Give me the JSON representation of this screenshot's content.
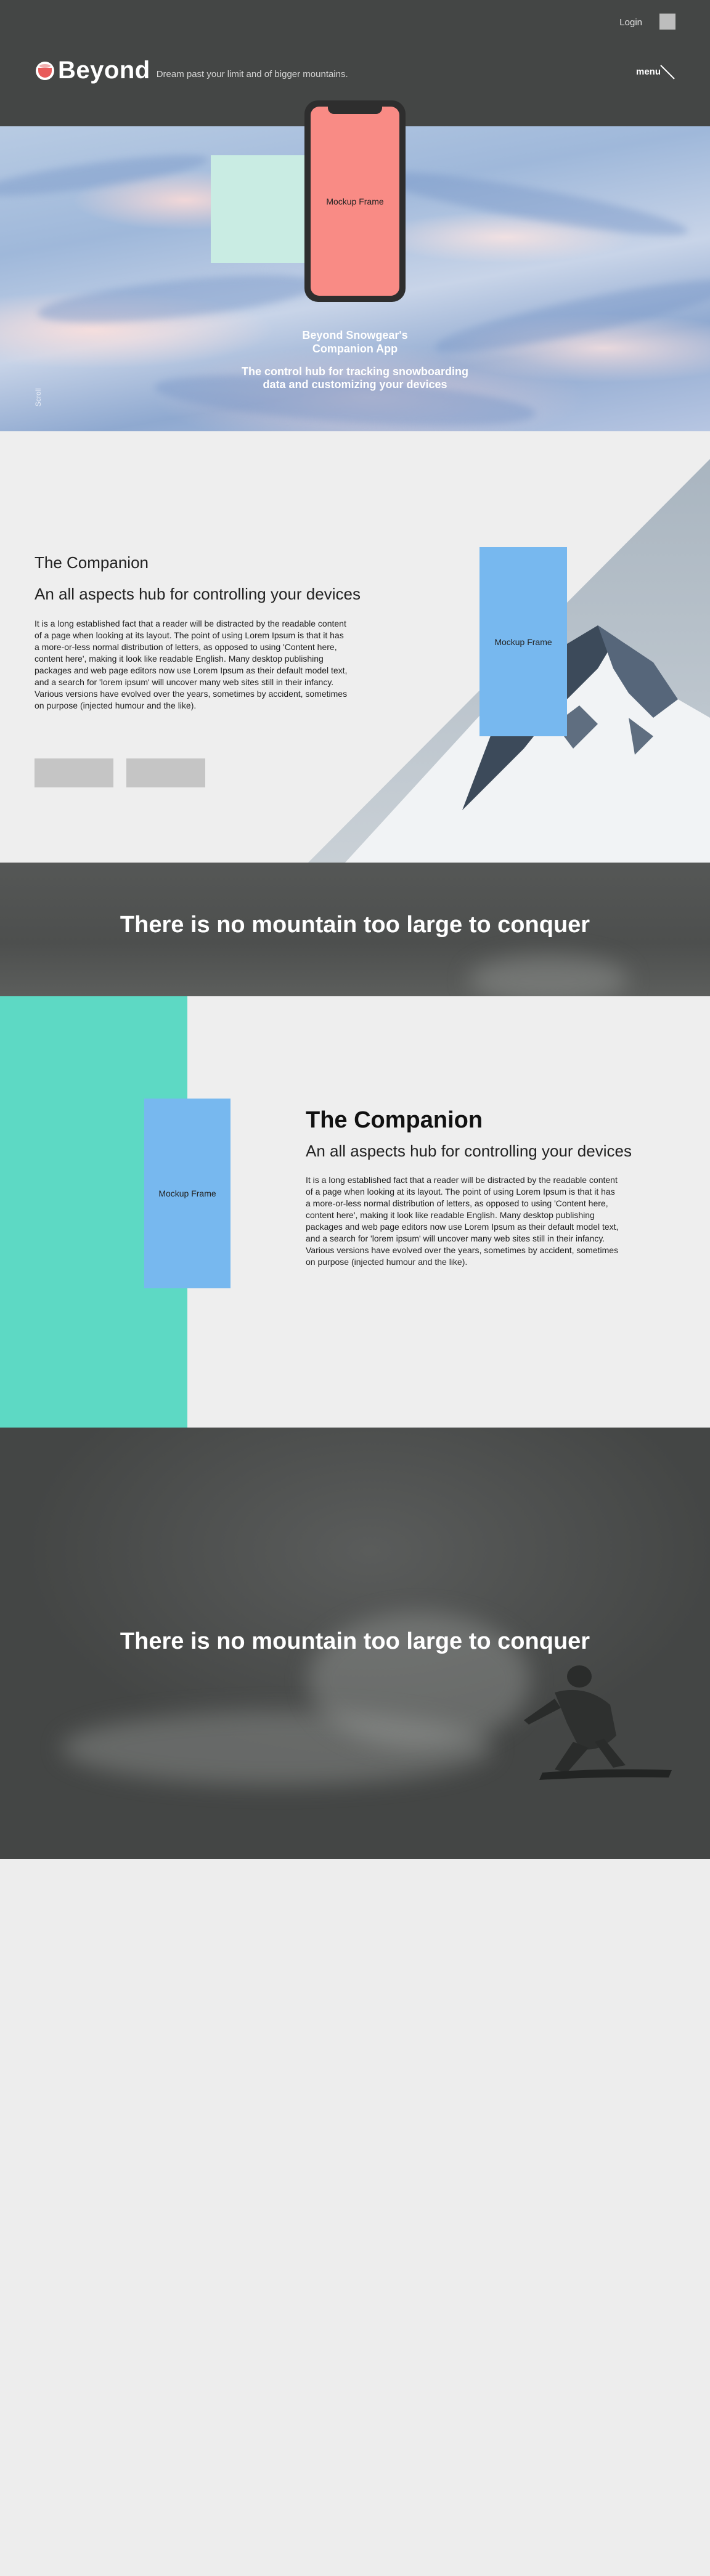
{
  "header": {
    "login_label": "Login",
    "brand_name": "Beyond",
    "tagline": "Dream past your limit and of bigger mountains.",
    "menu_label": "menu",
    "logo_icon": "beyond-logo",
    "menu_icon": "diagonal-line-icon"
  },
  "hero": {
    "phone_mockup_label": "Mockup Frame",
    "title_line1": "Beyond Snowgear's",
    "title_line2": "Companion App",
    "subtitle": "The control hub for tracking snowboarding data and customizing your devices",
    "scroll_label": "Scroll"
  },
  "companion1": {
    "title": "The Companion",
    "subtitle": "An all aspects hub for controlling your devices",
    "body": "It is a long established fact that a reader will be distracted by the readable content of a page when looking at its layout. The point of using Lorem Ipsum is that it has a more-or-less normal distribution of letters, as opposed to using 'Content here, content here', making it look like readable English. Many desktop publishing packages and web page editors now use Lorem Ipsum as their default model text, and a search for 'lorem ipsum' will uncover many web sites still in their infancy. Various versions have evolved over the years, sometimes by accident, sometimes on purpose (injected humour and the like).",
    "mockup_label": "Mockup Frame"
  },
  "banner1": {
    "text": "There is no mountain too large to conquer"
  },
  "companion2": {
    "title": "The Companion",
    "subtitle": "An all aspects hub for controlling your devices",
    "body": "It is a long established fact that a reader will be distracted by the readable content of a page when looking at its layout. The point of using Lorem Ipsum is that it has a more-or-less normal distribution of letters, as opposed to using 'Content here, content here', making it look like readable English. Many desktop publishing packages and web page editors now use Lorem Ipsum as their default model text, and a search for 'lorem ipsum' will uncover many web sites still in their infancy. Various versions have evolved over the years, sometimes by accident, sometimes on purpose (injected humour and the like).",
    "mockup_label": "Mockup Frame"
  },
  "banner2": {
    "text": "There is no mountain too large to conquer"
  },
  "colors": {
    "header_bg": "#444645",
    "phone_screen": "#f98b85",
    "mockup_blue": "#77b8ef",
    "teal_accent": "#5dd9c4",
    "mint_rect": "#c9ece3",
    "button_gray": "#c5c5c5"
  }
}
